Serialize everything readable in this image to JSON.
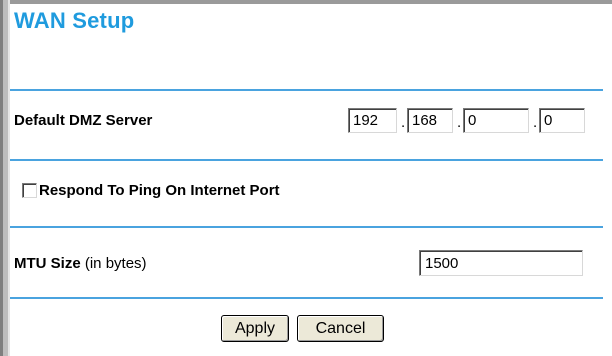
{
  "header": {
    "title": "WAN Setup"
  },
  "dmz": {
    "label": "Default DMZ Server",
    "ip": [
      "192",
      "168",
      "0",
      "0"
    ],
    "separator": "."
  },
  "ping": {
    "label": "Respond To Ping On Internet Port",
    "checked": false
  },
  "mtu": {
    "label_bold": "MTU Size",
    "label_unit": " (in bytes)",
    "value": "1500"
  },
  "buttons": {
    "apply": "Apply",
    "cancel": "Cancel"
  },
  "colors": {
    "title": "#1f9bde",
    "divider": "#4aa3df"
  }
}
